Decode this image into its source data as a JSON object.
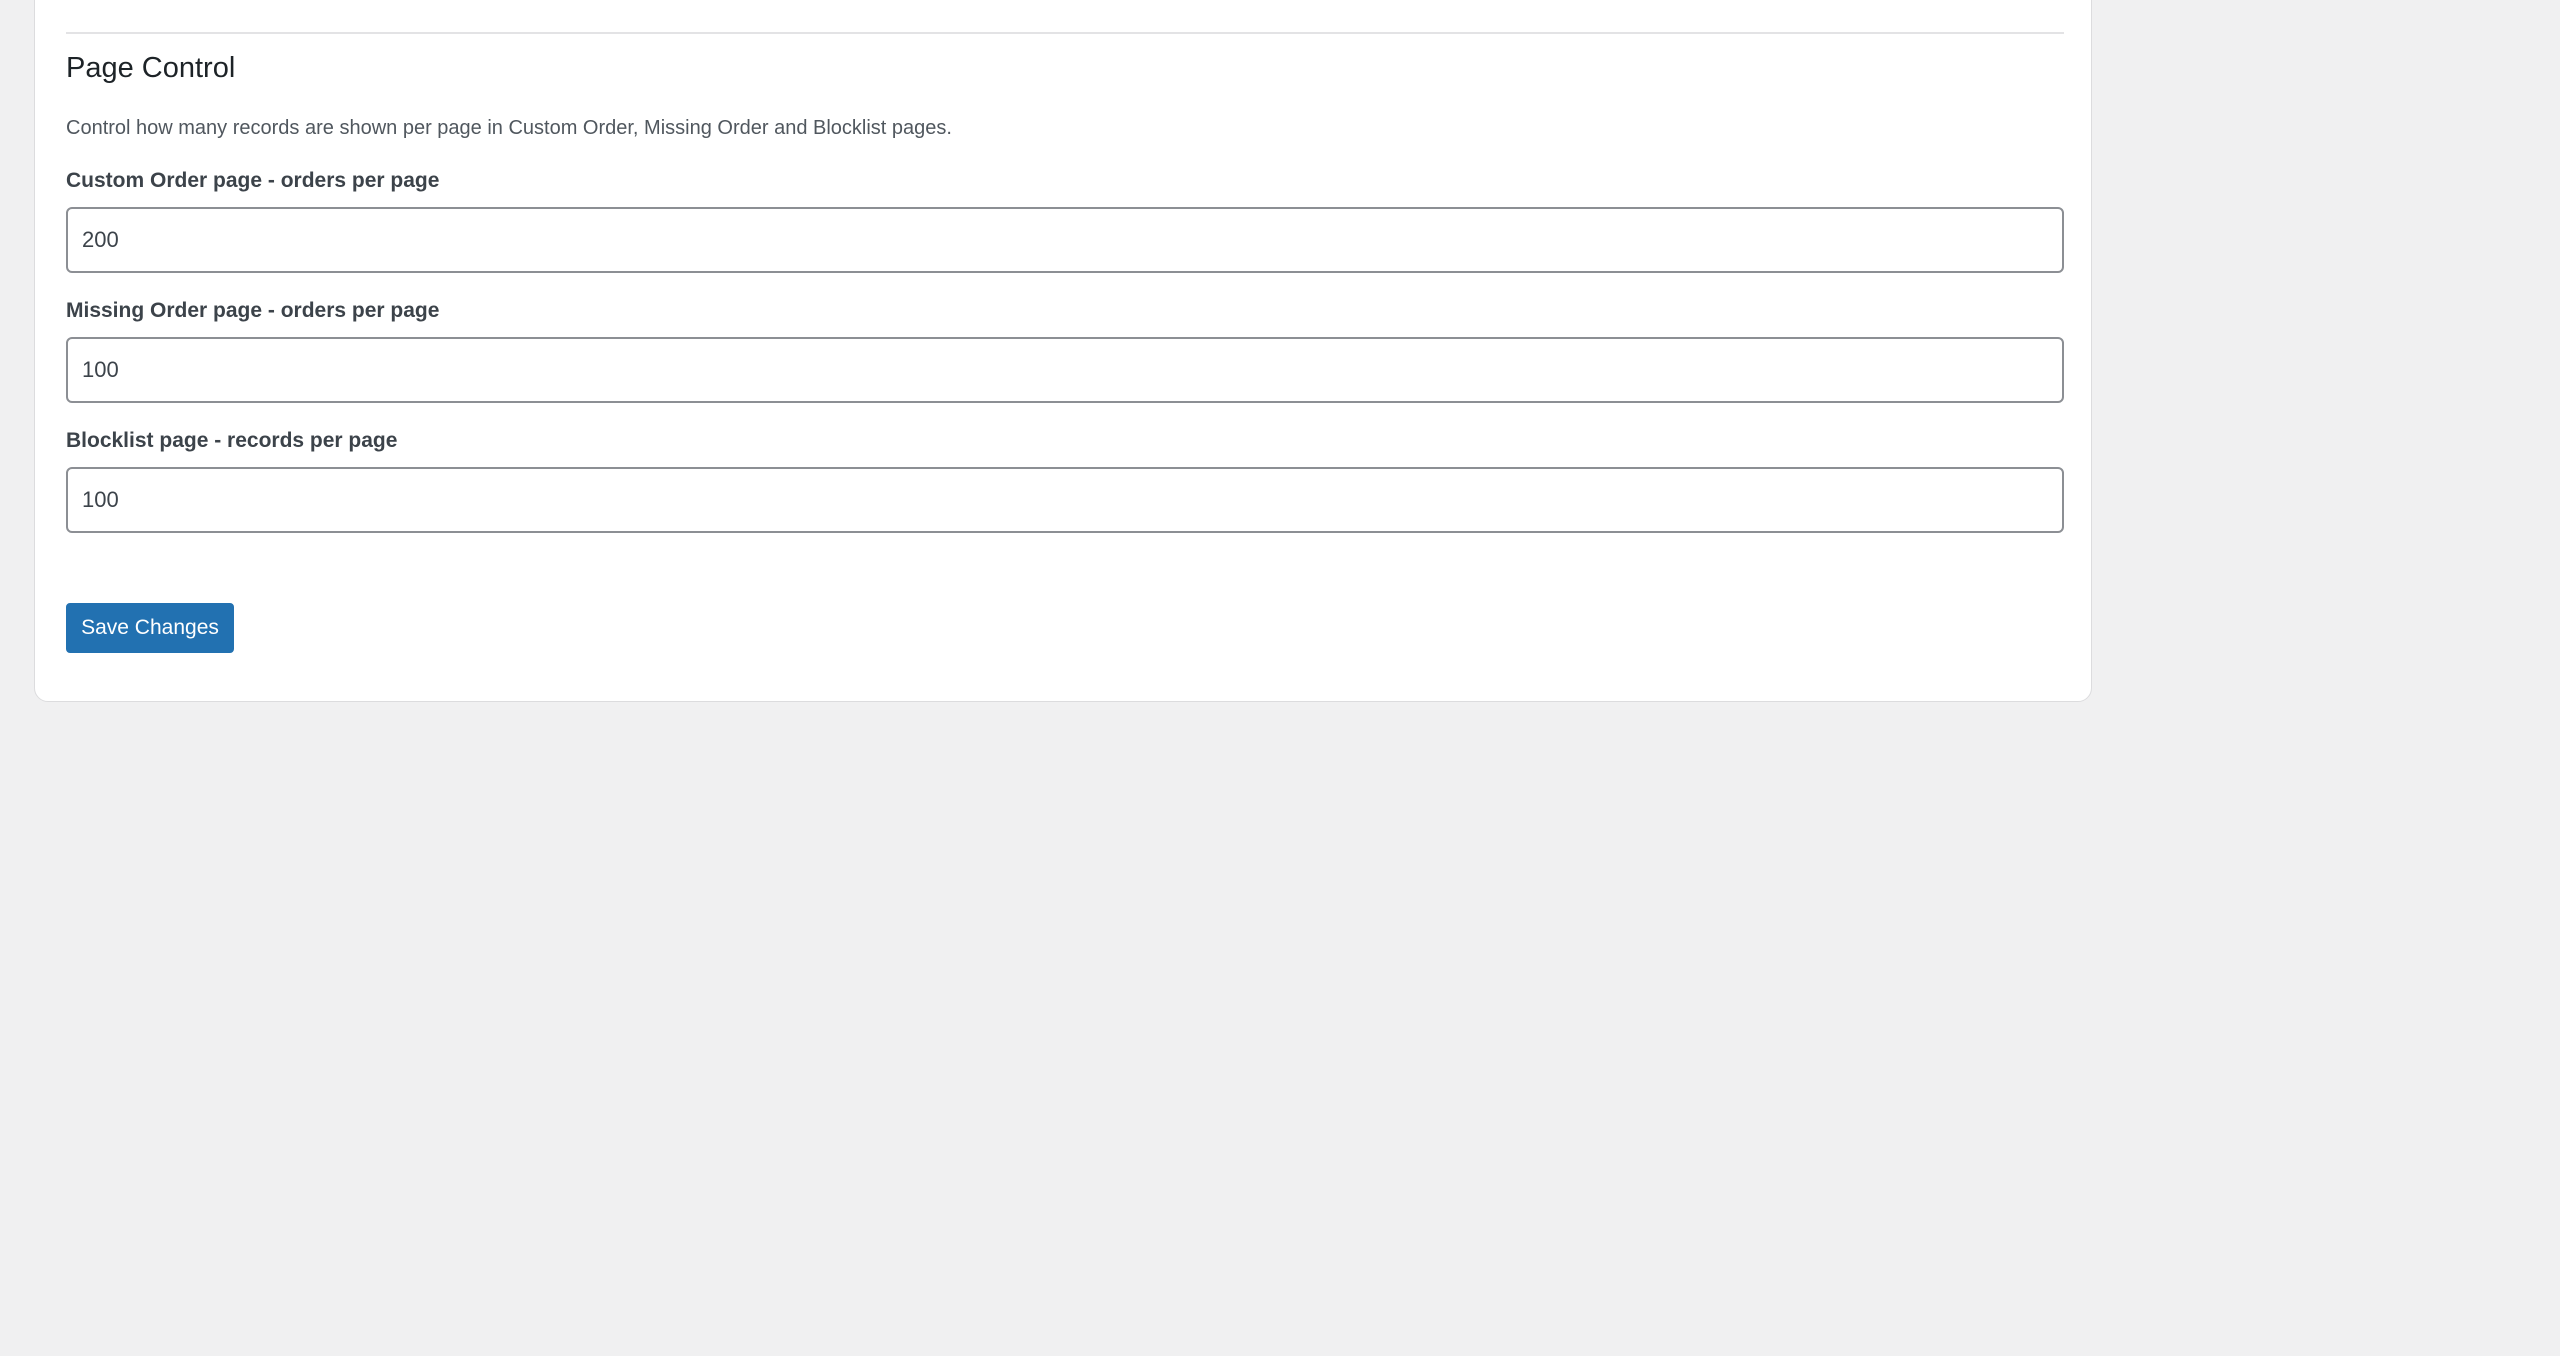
{
  "section": {
    "title": "Page Control",
    "description": "Control how many records are shown per page in Custom Order, Missing Order and Blocklist pages."
  },
  "fields": [
    {
      "label": "Custom Order page - orders per page",
      "value": "200"
    },
    {
      "label": "Missing Order page - orders per page",
      "value": "100"
    },
    {
      "label": "Blocklist page - records per page",
      "value": "100"
    }
  ],
  "actions": {
    "save_label": "Save Changes"
  },
  "colors": {
    "background": "#f0f0f1",
    "card": "#ffffff",
    "primary_button": "#2271b1",
    "input_border": "#8c8f94"
  }
}
